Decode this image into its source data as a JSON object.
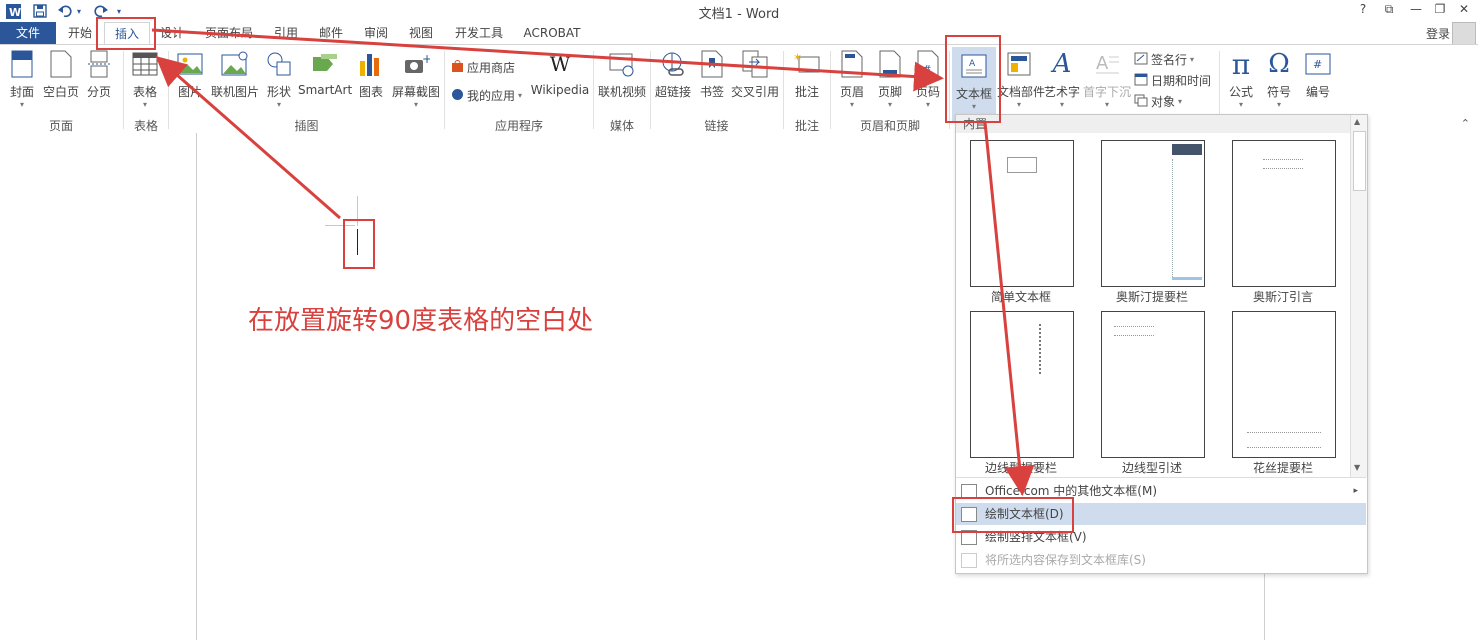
{
  "window": {
    "title": "文档1 - Word",
    "help": "?",
    "ribbon_display": "⧉",
    "minimize": "—",
    "restore": "❐",
    "close": "✕",
    "login": "登录"
  },
  "tabs": [
    "文件",
    "开始",
    "插入",
    "设计",
    "页面布局",
    "引用",
    "邮件",
    "审阅",
    "视图",
    "开发工具",
    "ACROBAT"
  ],
  "ribbon": {
    "buttons": {
      "cover": "封面",
      "blank_page": "空白页",
      "page_break": "分页",
      "table": "表格",
      "picture": "图片",
      "online_picture": "联机图片",
      "shapes": "形状",
      "smartart": "SmartArt",
      "chart": "图表",
      "screenshot": "屏幕截图",
      "app_store": "应用商店",
      "my_apps": "我的应用",
      "wikipedia": "Wikipedia",
      "online_video": "联机视频",
      "hyperlink": "超链接",
      "bookmark": "书签",
      "cross_ref": "交叉引用",
      "comment": "批注",
      "header": "页眉",
      "footer": "页脚",
      "page_number": "页码",
      "text_box": "文本框",
      "quick_parts": "文档部件",
      "wordart": "艺术字",
      "drop_cap": "首字下沉",
      "signature_line": "签名行",
      "date_time": "日期和时间",
      "object": "对象",
      "equation": "公式",
      "symbol": "符号",
      "numbering": "编号"
    },
    "groups": {
      "pages": "页面",
      "tables": "表格",
      "illustrations": "插图",
      "apps": "应用程序",
      "media": "媒体",
      "links": "链接",
      "comments": "批注",
      "header_footer": "页眉和页脚"
    },
    "dropdown_arrow": "▾"
  },
  "textbox_gallery": {
    "header": "内置",
    "items": [
      "简单文本框",
      "奥斯汀提要栏",
      "奥斯汀引言",
      "边线型提要栏",
      "边线型引述",
      "花丝提要栏"
    ],
    "menu": [
      {
        "label": "Office.com 中的其他文本框(M)",
        "enabled": true
      },
      {
        "label": "绘制文本框(D)",
        "enabled": true,
        "highlighted": true
      },
      {
        "label": "绘制竖排文本框(V)",
        "enabled": true
      },
      {
        "label": "将所选内容保存到文本框库(S)",
        "enabled": false
      }
    ]
  },
  "annotation": {
    "text": "在放置旋转90度表格的空白处",
    "color": "#d8413d"
  },
  "colors": {
    "accent": "#2b579a",
    "annotation_red": "#d8413d",
    "menu_highlight": "#cfdcee"
  }
}
